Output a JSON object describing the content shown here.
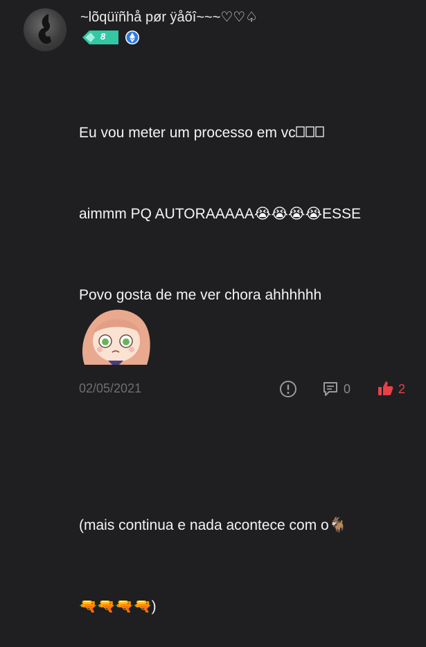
{
  "author": {
    "name": "~lõqüïñhå pør ÿåõî~~~♡♡♤",
    "level": "8",
    "avatar_icon": "avatar-silhouette",
    "verified_icon": "ethereum-badge-icon"
  },
  "message": {
    "line1": "Eu vou meter  um processo  em vc",
    "line2a": "aimmm PQ AUTORAAAAA",
    "line2_emoji": "😭😭😭😭",
    "line2b": "ESSE",
    "line3": "Povo gosta  de me ver chora ahhhhhh",
    "line4a": "(mais continua  e nada  acontece  com o",
    "line4_emoji": "🐐",
    "line5_emoji": "🔫🔫🔫🔫",
    "line5b": ")"
  },
  "sticker": {
    "icon": "anime-girl-sticker"
  },
  "footer": {
    "date": "02/05/2021",
    "comment_count": "0",
    "like_count": "2"
  },
  "colors": {
    "background": "#1f1f21",
    "like_accent": "#e8414a",
    "level_badge": "#34c7a4"
  }
}
